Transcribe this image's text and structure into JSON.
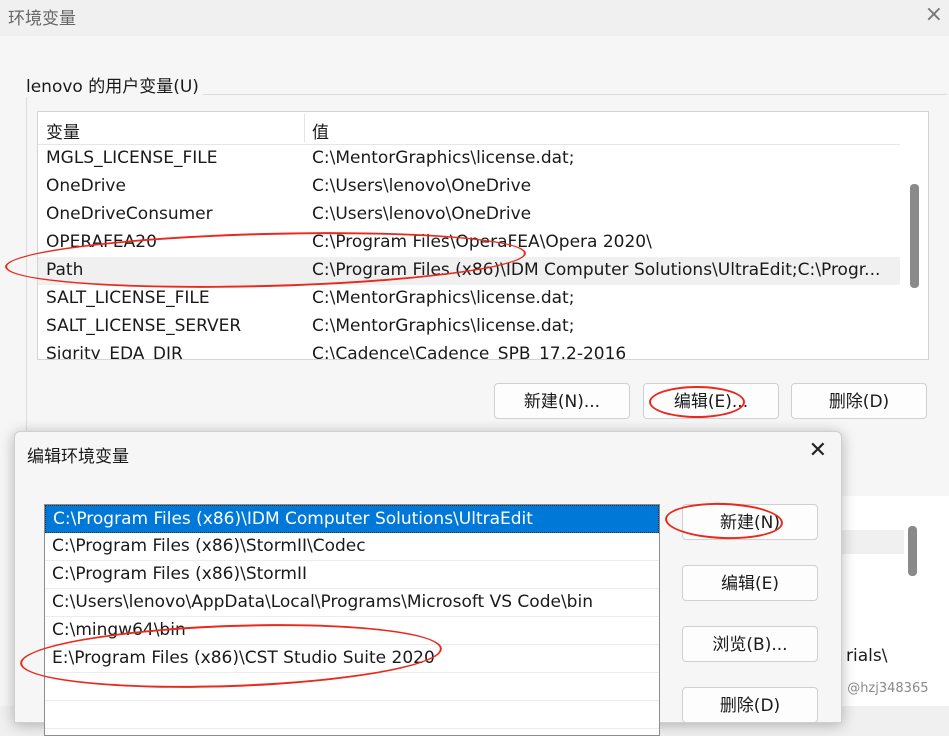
{
  "window": {
    "title": "环境变量",
    "close_icon": "×"
  },
  "user_vars": {
    "group_label": "lenovo 的用户变量(U)",
    "col_name": "变量",
    "col_value": "值",
    "rows": [
      {
        "name": "MGLS_LICENSE_FILE",
        "value": "C:\\MentorGraphics\\license.dat;"
      },
      {
        "name": "OneDrive",
        "value": "C:\\Users\\lenovo\\OneDrive"
      },
      {
        "name": "OneDriveConsumer",
        "value": "C:\\Users\\lenovo\\OneDrive"
      },
      {
        "name": "OPERAFEA20",
        "value": "C:\\Program Files\\OperaFEA\\Opera 2020\\"
      },
      {
        "name": "Path",
        "value": "C:\\Program Files (x86)\\IDM Computer Solutions\\UltraEdit;C:\\Progr..."
      },
      {
        "name": "SALT_LICENSE_FILE",
        "value": "C:\\MentorGraphics\\license.dat;"
      },
      {
        "name": "SALT_LICENSE_SERVER",
        "value": "C:\\MentorGraphics\\license.dat;"
      },
      {
        "name": "Sigrity_EDA_DIR",
        "value": "C:\\Cadence\\Cadence_SPB_17.2-2016"
      }
    ],
    "buttons": {
      "new": "新建(N)...",
      "edit": "编辑(E)...",
      "delete": "删除(D)"
    }
  },
  "background_fragment": "rials\\",
  "watermark": "CSDN @hzj348365",
  "dialog": {
    "title": "编辑环境变量",
    "close_icon": "✕",
    "paths": [
      "C:\\Program Files (x86)\\IDM Computer Solutions\\UltraEdit",
      "C:\\Program Files (x86)\\StormII\\Codec",
      "C:\\Program Files (x86)\\StormII",
      "C:\\Users\\lenovo\\AppData\\Local\\Programs\\Microsoft VS Code\\bin",
      "C:\\mingw64\\bin",
      "E:\\Program Files (x86)\\CST Studio Suite 2020",
      "",
      ""
    ],
    "buttons": {
      "new": "新建(N)",
      "edit": "编辑(E)",
      "browse": "浏览(B)...",
      "delete": "删除(D)"
    }
  },
  "colors": {
    "selection": "#0078d7",
    "annotation": "#e8291c"
  }
}
